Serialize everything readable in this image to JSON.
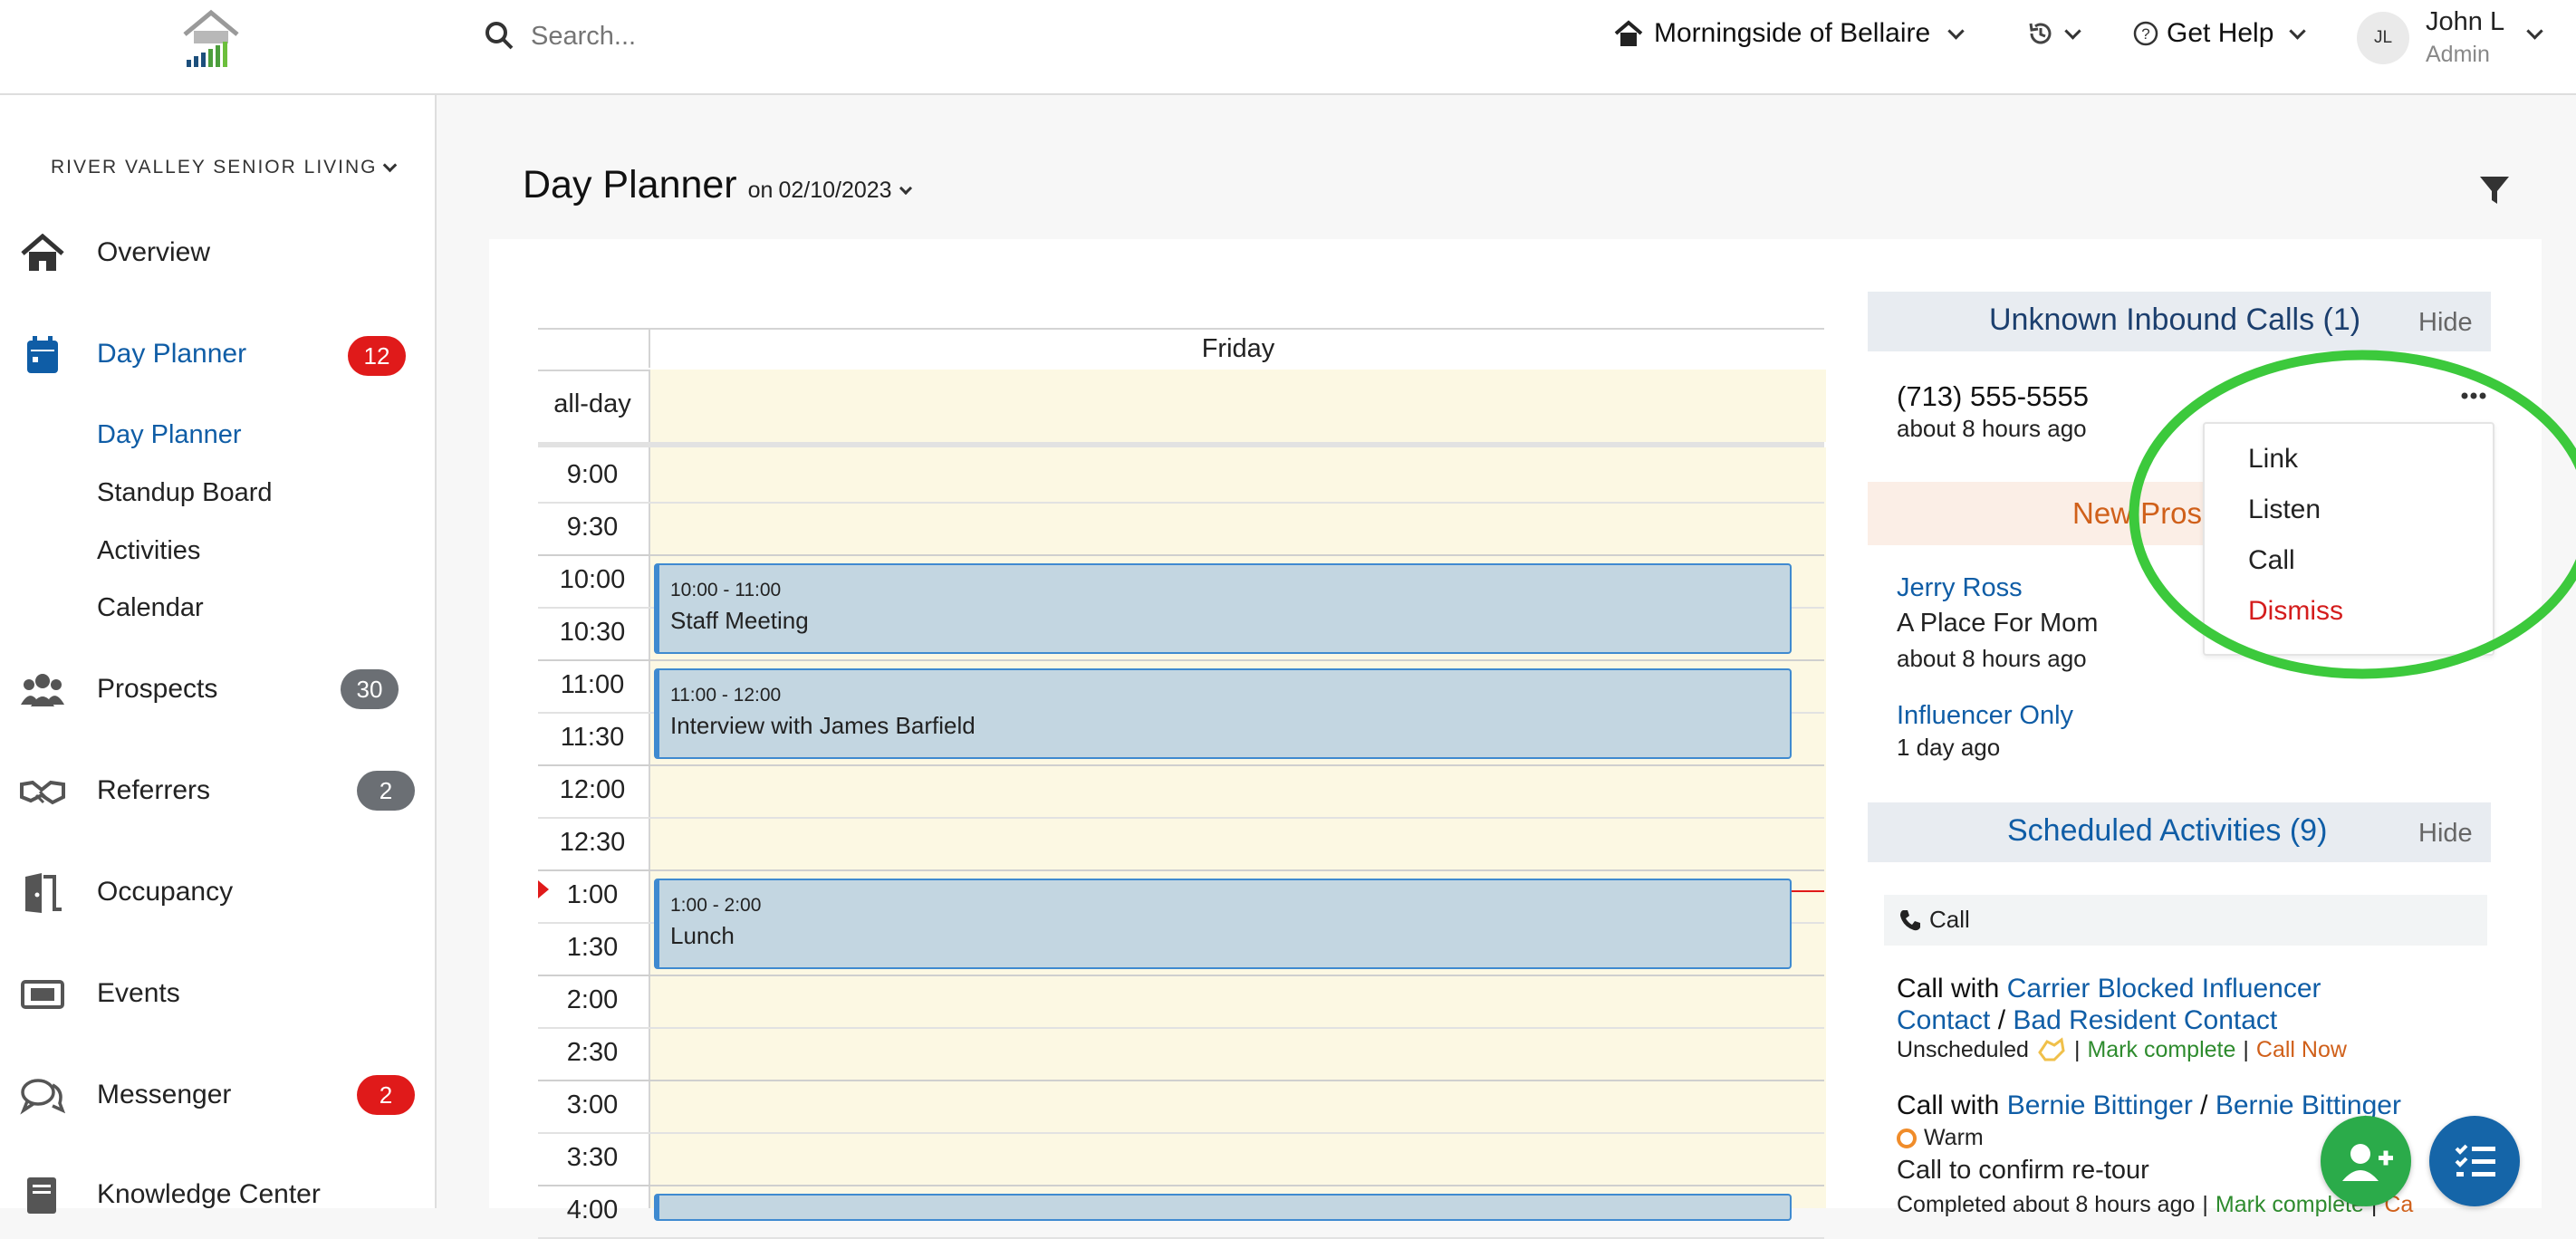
{
  "topbar": {
    "search_placeholder": "Search...",
    "community": "Morningside of Bellaire",
    "help": "Get Help",
    "user_initials": "JL",
    "user_name": "John L",
    "user_role": "Admin"
  },
  "sidebar": {
    "org": "RIVER VALLEY SENIOR LIVING",
    "items": [
      {
        "label": "Overview",
        "icon": "home-icon"
      },
      {
        "label": "Day Planner",
        "icon": "calendar-icon",
        "badge": "12"
      },
      {
        "label": "Prospects",
        "icon": "users-icon",
        "badge": "30"
      },
      {
        "label": "Referrers",
        "icon": "handshake-icon",
        "badge": "2"
      },
      {
        "label": "Occupancy",
        "icon": "door-icon"
      },
      {
        "label": "Events",
        "icon": "ticket-icon"
      },
      {
        "label": "Messenger",
        "icon": "chat-icon",
        "badge": "2"
      },
      {
        "label": "Knowledge Center",
        "icon": "book-icon"
      }
    ],
    "sub_items": [
      "Day Planner",
      "Standup Board",
      "Activities",
      "Calendar"
    ]
  },
  "page": {
    "title": "Day Planner",
    "date_prefix": "on",
    "date": "02/10/2023"
  },
  "calendar": {
    "day": "Friday",
    "all_day": "all-day",
    "times": [
      "9:00",
      "9:30",
      "10:00",
      "10:30",
      "11:00",
      "11:30",
      "12:00",
      "12:30",
      "1:00",
      "1:30",
      "2:00",
      "2:30",
      "3:00",
      "3:30",
      "4:00"
    ],
    "events": [
      {
        "time": "10:00 - 11:00",
        "name": "Staff Meeting"
      },
      {
        "time": "11:00 - 12:00",
        "name": "Interview with James Barfield"
      },
      {
        "time": "1:00 - 2:00",
        "name": "Lunch"
      }
    ]
  },
  "unknown_calls": {
    "title": "Unknown Inbound Calls (1)",
    "hide": "Hide",
    "phone": "(713) 555-5555",
    "ago": "about 8 hours ago",
    "menu": [
      "Link",
      "Listen",
      "Call",
      "Dismiss"
    ]
  },
  "new_prospects": {
    "title_partial": "New Pros",
    "items": [
      {
        "name": "Jerry Ross",
        "source": "A Place For Mom",
        "ago": "about 8 hours ago"
      },
      {
        "name": "Influencer Only",
        "ago": "1 day ago"
      }
    ]
  },
  "scheduled": {
    "title": "Scheduled Activities (9)",
    "hide": "Hide",
    "group": "Call",
    "a1": {
      "prefix": "Call with",
      "link1": "Carrier Blocked Influencer",
      "link2": "Contact",
      "sep": "/",
      "link3": "Bad Resident Contact",
      "status": "Unscheduled",
      "pipe": "|",
      "mark": "Mark complete",
      "callnow": "Call Now"
    },
    "a2": {
      "prefix": "Call with",
      "link1": "Bernie Bittinger",
      "sep": "/",
      "link2": "Bernie Bittinger",
      "temp": "Warm",
      "desc": "Call to confirm re-tour",
      "completed": "Completed about 8 hours ago",
      "pipe": "|",
      "mark": "Mark complete",
      "cut": "Ca"
    }
  },
  "colors": {
    "accent": "#0f5da6",
    "badge_red": "#e01a1a",
    "badge_gray": "#6b6f74",
    "event_bg": "#c3d6e1",
    "day_bg": "#fcf8e3",
    "annotation_circle": "#3cc93c",
    "fab_green": "#2bab4a",
    "fab_blue": "#1565a8"
  }
}
